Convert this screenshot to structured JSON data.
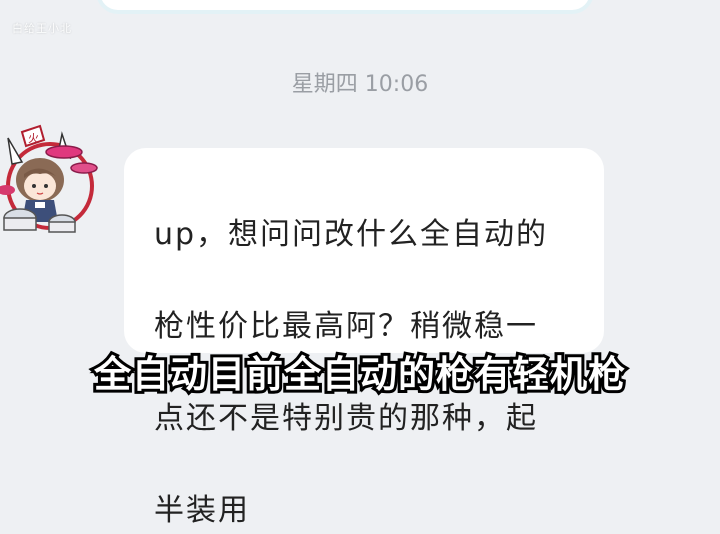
{
  "watermark": "白给王小北",
  "chat": {
    "timestamp": "星期四 10:06",
    "message": {
      "lines": [
        "up，想问问改什么全自动的",
        "枪性价比最高阿？稍微稳一",
        "点还不是特别贵的那种，起",
        "半装用"
      ]
    }
  },
  "subtitle": "全自动目前全自动的枪有轻机枪",
  "colors": {
    "background": "#eef0f3",
    "bubble": "#ffffff",
    "timestamp": "#9a9ea4",
    "text": "#222222"
  }
}
